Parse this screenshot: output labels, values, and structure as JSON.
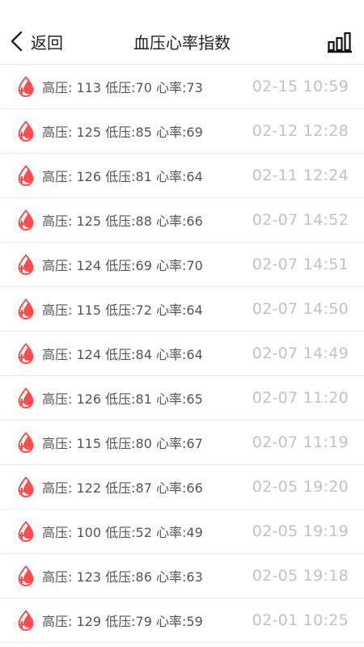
{
  "header": {
    "back_label": "返回",
    "title": "血压心率指数"
  },
  "icons": {
    "back": "chevron-left-icon",
    "chart": "bar-chart-icon",
    "row": "blood-drop-plus-icon"
  },
  "colors": {
    "accent": "#ff4d4f",
    "timestamp": "#c2c2c2"
  },
  "records": [
    {
      "high_label": "高压:",
      "high": "113",
      "low_label": "低压:",
      "low": "70",
      "hr_label": "心率:",
      "hr": "73",
      "time": "02-15 10:59"
    },
    {
      "high_label": "高压:",
      "high": "125",
      "low_label": "低压:",
      "low": "85",
      "hr_label": "心率:",
      "hr": "69",
      "time": "02-12 12:28"
    },
    {
      "high_label": "高压:",
      "high": "126",
      "low_label": "低压:",
      "low": "81",
      "hr_label": "心率:",
      "hr": "64",
      "time": "02-11 12:24"
    },
    {
      "high_label": "高压:",
      "high": "125",
      "low_label": "低压:",
      "low": "88",
      "hr_label": "心率:",
      "hr": "66",
      "time": "02-07 14:52"
    },
    {
      "high_label": "高压:",
      "high": "124",
      "low_label": "低压:",
      "low": "69",
      "hr_label": "心率:",
      "hr": "70",
      "time": "02-07 14:51"
    },
    {
      "high_label": "高压:",
      "high": "115",
      "low_label": "低压:",
      "low": "72",
      "hr_label": "心率:",
      "hr": "64",
      "time": "02-07 14:50"
    },
    {
      "high_label": "高压:",
      "high": "124",
      "low_label": "低压:",
      "low": "84",
      "hr_label": "心率:",
      "hr": "64",
      "time": "02-07 14:49"
    },
    {
      "high_label": "高压:",
      "high": "126",
      "low_label": "低压:",
      "low": "81",
      "hr_label": "心率:",
      "hr": "65",
      "time": "02-07 11:20"
    },
    {
      "high_label": "高压:",
      "high": "115",
      "low_label": "低压:",
      "low": "80",
      "hr_label": "心率:",
      "hr": "67",
      "time": "02-07 11:19"
    },
    {
      "high_label": "高压:",
      "high": "122",
      "low_label": "低压:",
      "low": "87",
      "hr_label": "心率:",
      "hr": "66",
      "time": "02-05 19:20"
    },
    {
      "high_label": "高压:",
      "high": "100",
      "low_label": "低压:",
      "low": "52",
      "hr_label": "心率:",
      "hr": "49",
      "time": "02-05 19:19"
    },
    {
      "high_label": "高压:",
      "high": "123",
      "low_label": "低压:",
      "low": "86",
      "hr_label": "心率:",
      "hr": "63",
      "time": "02-05 19:18"
    },
    {
      "high_label": "高压:",
      "high": "129",
      "low_label": "低压:",
      "low": "79",
      "hr_label": "心率:",
      "hr": "59",
      "time": "02-01 10:25"
    }
  ]
}
